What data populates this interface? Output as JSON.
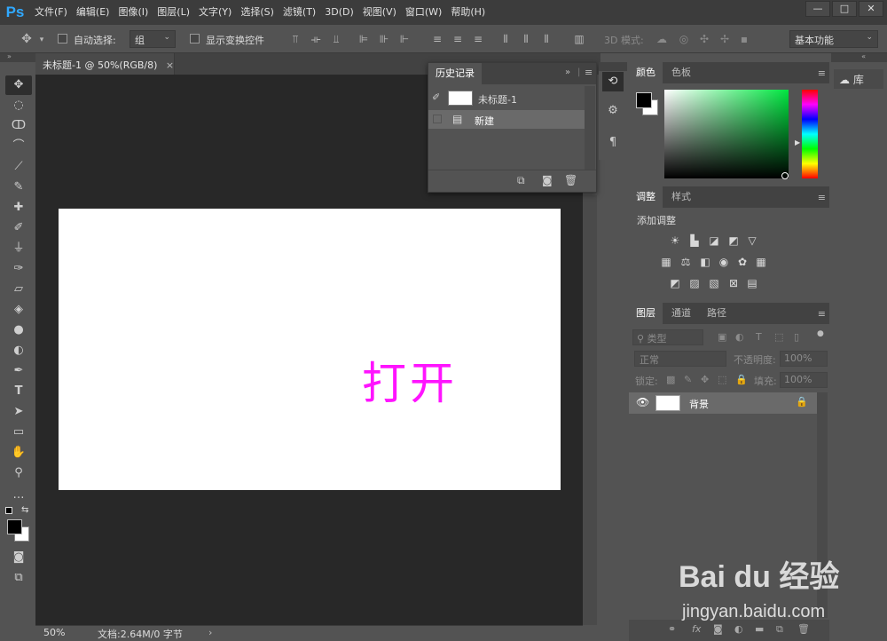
{
  "app": {
    "logo": "Ps"
  },
  "menu": [
    "文件(F)",
    "编辑(E)",
    "图像(I)",
    "图层(L)",
    "文字(Y)",
    "选择(S)",
    "滤镜(T)",
    "3D(D)",
    "视图(V)",
    "窗口(W)",
    "帮助(H)"
  ],
  "window_controls": [
    "—",
    "□",
    "✕"
  ],
  "options": {
    "auto_select_label": "自动选择:",
    "auto_select_value": "组",
    "show_transform_label": "显示变换控件",
    "mode_3d_label": "3D 模式:",
    "workspace": "基本功能"
  },
  "document": {
    "tab_title": "未标题-1 @ 50%(RGB/8)",
    "tab_close": "×",
    "canvas_text": "打开",
    "canvas_text_color": "#ff14ff",
    "zoom": "50%",
    "doc_info": "文档:2.64M/0 字节"
  },
  "history": {
    "tab": "历史记录",
    "snapshot_label": "未标题-1",
    "entries": [
      "新建"
    ]
  },
  "color_panel": {
    "tabs": [
      "颜色",
      "色板"
    ],
    "foreground": "#000000",
    "background": "#ffffff"
  },
  "adjustments": {
    "tabs": [
      "调整",
      "样式"
    ],
    "title": "添加调整"
  },
  "layers": {
    "tabs": [
      "图层",
      "通道",
      "路径"
    ],
    "filter_kind": "类型",
    "blend_mode": "正常",
    "opacity_label": "不透明度:",
    "opacity_value": "100%",
    "lock_label": "锁定:",
    "fill_label": "填充:",
    "fill_value": "100%",
    "layer_name": "背景"
  },
  "library": {
    "label": "库"
  },
  "watermark": {
    "logo": "Bai du 经验",
    "url": "jingyan.baidu.com"
  }
}
